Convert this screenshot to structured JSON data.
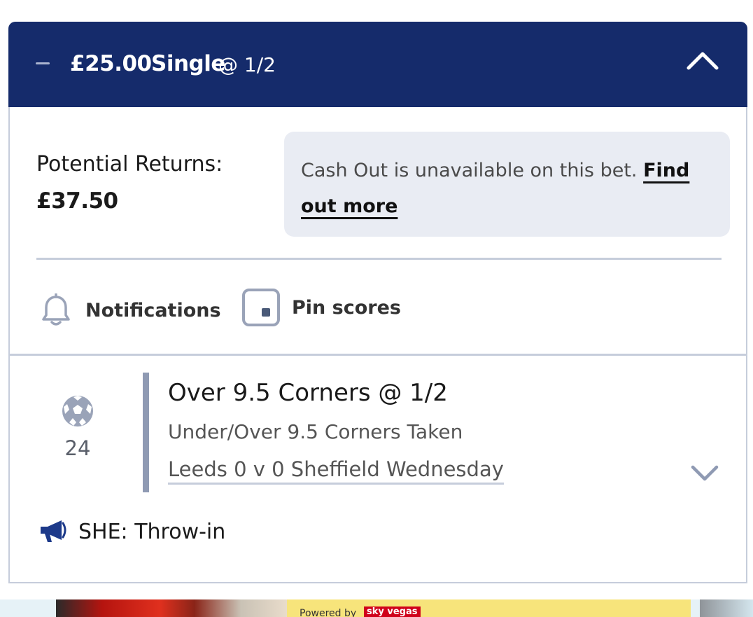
{
  "header": {
    "stake": "£25.00",
    "bet_type": "Single",
    "odds": "@ 1/2"
  },
  "returns": {
    "label": "Potential Returns:",
    "value": "£37.50"
  },
  "cashout": {
    "message": "Cash Out is unavailable on this bet. ",
    "link_label": "Find out more"
  },
  "actions": {
    "notifications_label": "Notifications",
    "pin_scores_label": "Pin scores"
  },
  "selection": {
    "minute": "24",
    "title": "Over 9.5 Corners @ 1/2",
    "market": "Under/Over 9.5 Corners Taken",
    "event": "Leeds 0 v 0 Sheffield Wednesday"
  },
  "commentary": {
    "text": "SHE: Throw-in"
  },
  "banner": {
    "powered_by": "Powered by",
    "brand": "sky vegas"
  },
  "colors": {
    "header_bg": "#152b6b",
    "border": "#c6cddb",
    "panel_bg": "#e9ecf3",
    "accent_bar": "#8f9ab3"
  },
  "icons": [
    "minus-icon",
    "chevron-up-icon",
    "bell-icon",
    "pin-square-icon",
    "football-icon",
    "chevron-down-icon",
    "megaphone-icon"
  ]
}
